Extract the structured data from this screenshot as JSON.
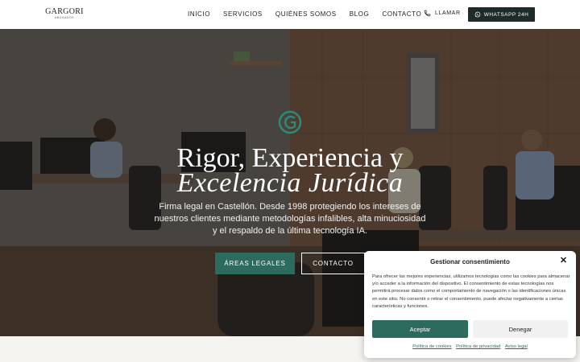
{
  "header": {
    "logo_main": "GARGORI",
    "logo_sub": "ABOGADOS",
    "nav": [
      "INICIO",
      "SERVICIOS",
      "QUIÉNES SOMOS",
      "BLOG",
      "CONTACTO"
    ],
    "call_label": "LLAMAR",
    "whatsapp_label": "WHATSAPP 24H"
  },
  "hero": {
    "title_line1": "Rigor, Experiencia y",
    "title_line2": "Excelencia Jurídica",
    "subtitle": "Firma legal en Castellón. Desde 1998 protegiendo los intereses de nuestros clientes mediante metodologías infalibles, alta minuciosidad y el respaldo de la última tecnología IA.",
    "btn_areas": "ÁREAS LEGALES",
    "btn_contacto": "CONTACTO"
  },
  "cookie": {
    "title": "Gestionar consentimiento",
    "close": "✕",
    "text": "Para ofrecer las mejores experiencias, utilizamos tecnologías como las cookies para almacenar y/o acceder a la información del dispositivo. El consentimiento de estas tecnologías nos permitirá procesar datos como el comportamiento de navegación o las identificaciones únicas en este sitio. No consentir o retirar el consentimiento, puede afectar negativamente a ciertas características y funciones.",
    "accept": "Aceptar",
    "deny": "Denegar",
    "links": [
      "Política de cookies",
      "Política de privacidad",
      "Aviso legal"
    ]
  },
  "colors": {
    "accent": "#2e6b5f",
    "dark_button": "#1f2a2a"
  },
  "icons": [
    "phone-icon",
    "whatsapp-icon",
    "logo-emblem-icon",
    "close-icon"
  ]
}
